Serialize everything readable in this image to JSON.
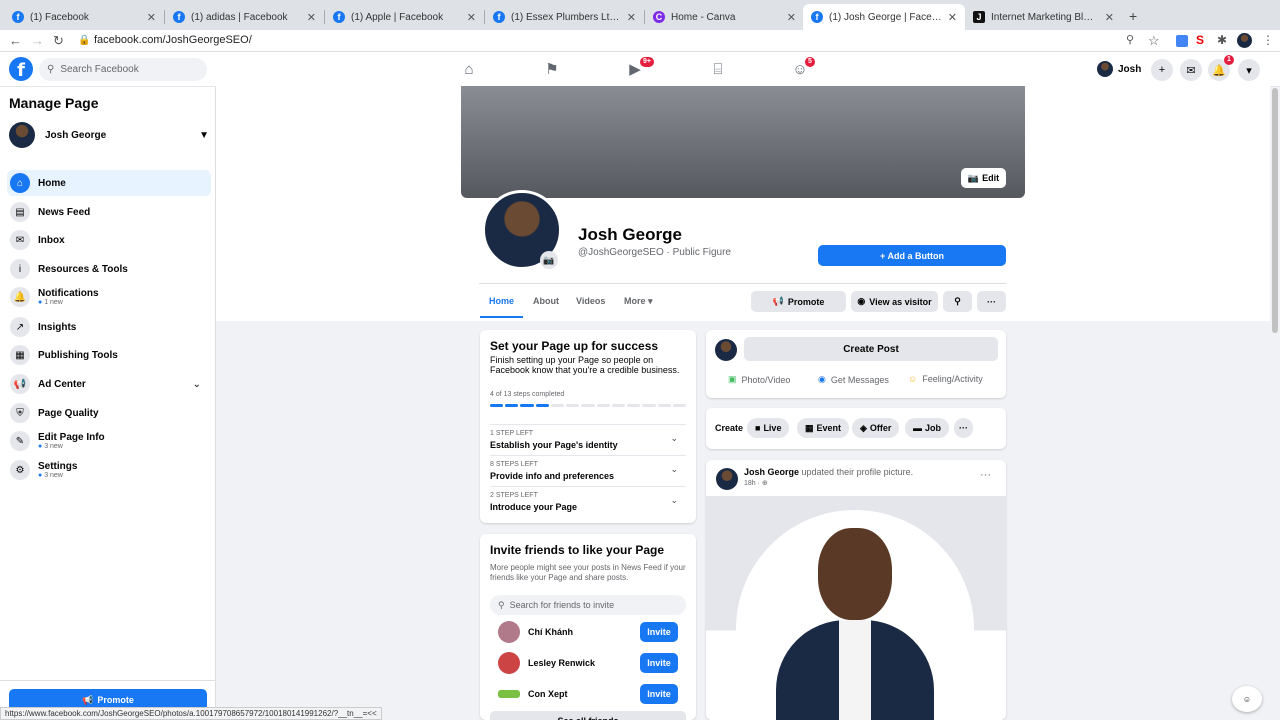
{
  "browser": {
    "tabs": [
      {
        "title": "(1) Facebook",
        "icon": "facebook-icon"
      },
      {
        "title": "(1) adidas | Facebook",
        "icon": "facebook-icon"
      },
      {
        "title": "(1) Apple | Facebook",
        "icon": "facebook-icon"
      },
      {
        "title": "(1) Essex Plumbers Ltd | Faceb",
        "icon": "facebook-icon"
      },
      {
        "title": "Home - Canva",
        "icon": "canva-icon"
      },
      {
        "title": "(1) Josh George | Facebook",
        "icon": "facebook-icon"
      },
      {
        "title": "Internet Marketing Blogger | Jo",
        "icon": "jg-icon"
      }
    ],
    "url": "facebook.com/JoshGeorgeSEO/",
    "status_url": "https://www.facebook.com/JoshGeorgeSEO/photos/a.100179708657972/100180141991262/?__tn__=<<"
  },
  "header": {
    "search_placeholder": "Search Facebook",
    "user_name": "Josh",
    "badges": {
      "watch": "9+",
      "groups": "5",
      "notifications": "1"
    }
  },
  "sidebar": {
    "title": "Manage Page",
    "page_name": "Josh George",
    "items": [
      {
        "label": "Home",
        "icon": "home-icon",
        "sub": ""
      },
      {
        "label": "News Feed",
        "icon": "news-feed-icon",
        "sub": ""
      },
      {
        "label": "Inbox",
        "icon": "inbox-icon",
        "sub": ""
      },
      {
        "label": "Resources & Tools",
        "icon": "info-icon",
        "sub": ""
      },
      {
        "label": "Notifications",
        "icon": "bell-icon",
        "sub": "1 new"
      },
      {
        "label": "Insights",
        "icon": "insights-icon",
        "sub": ""
      },
      {
        "label": "Publishing Tools",
        "icon": "publishing-icon",
        "sub": ""
      },
      {
        "label": "Ad Center",
        "icon": "megaphone-icon",
        "sub": ""
      },
      {
        "label": "Page Quality",
        "icon": "shield-icon",
        "sub": ""
      },
      {
        "label": "Edit Page Info",
        "icon": "pencil-icon",
        "sub": "3 new"
      },
      {
        "label": "Settings",
        "icon": "gear-icon",
        "sub": "3 new"
      }
    ],
    "promote_label": "Promote"
  },
  "profile": {
    "cover_edit": "Edit",
    "name": "Josh George",
    "handle": "@JoshGeorgeSEO · Public Figure",
    "add_button": "+ Add a Button",
    "tabs": [
      "Home",
      "About",
      "Videos",
      "More"
    ],
    "promote": "Promote",
    "view_as_visitor": "View as visitor"
  },
  "setup": {
    "title": "Set your Page up for success",
    "desc": "Finish setting up your Page so people on Facebook know that you're a credible business.",
    "progress_text": "4 of 13 steps completed",
    "progress_done": 4,
    "progress_total": 13,
    "steps": [
      {
        "small": "1 STEP LEFT",
        "big": "Establish your Page's identity"
      },
      {
        "small": "8 STEPS LEFT",
        "big": "Provide info and preferences"
      },
      {
        "small": "2 STEPS LEFT",
        "big": "Introduce your Page"
      }
    ]
  },
  "invite": {
    "title": "Invite friends to like your Page",
    "desc": "More people might see your posts in News Feed if your friends like your Page and share posts.",
    "search_placeholder": "Search for friends to invite",
    "friends": [
      {
        "name": "Chí Khánh",
        "action": "Invite"
      },
      {
        "name": "Lesley Renwick",
        "action": "Invite"
      },
      {
        "name": "Con Xept",
        "action": "Invite"
      }
    ],
    "see_all": "See all friends"
  },
  "composer": {
    "create_post": "Create Post",
    "actions": [
      "Photo/Video",
      "Get Messages",
      "Feeling/Activity"
    ]
  },
  "create_bar": {
    "label": "Create",
    "items": [
      "Live",
      "Event",
      "Offer",
      "Job"
    ]
  },
  "post": {
    "author": "Josh George",
    "action": "updated their profile picture.",
    "time": "18h"
  }
}
